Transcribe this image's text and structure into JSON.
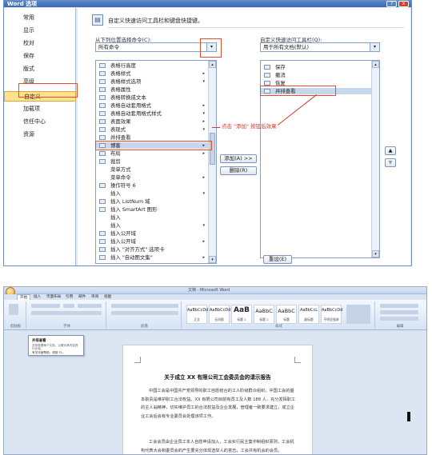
{
  "dialog": {
    "title": "Word 选项",
    "help_glyph": "?",
    "close_glyph": "x",
    "nav": {
      "items": [
        "常用",
        "显示",
        "校对",
        "保存",
        "版式",
        "高级",
        "自定义",
        "加载项",
        "信任中心",
        "资源"
      ],
      "selected_index": 6
    },
    "header_icon": "▤",
    "header_text": "自定义快速访问工具栏和键盘快捷键。",
    "left_label": "从下列位置选择命令(C):",
    "left_combo": "所有命令",
    "right_label": "自定义快速访问工具栏(Q):",
    "right_combo": "用于所有文档(默认)",
    "combo_arrow": "▾",
    "left_list": [
      {
        "text": "表格行高度",
        "chev": ""
      },
      {
        "text": "表格样式",
        "chev": "▸"
      },
      {
        "text": "表格样式选项",
        "chev": "▾"
      },
      {
        "text": "表格属性",
        "chev": ""
      },
      {
        "text": "表格转换成文本",
        "chev": ""
      },
      {
        "text": "表格自动套用格式",
        "chev": "▸"
      },
      {
        "text": "表格自动套用格式样式",
        "chev": "▾"
      },
      {
        "text": "表面效果",
        "chev": "▸"
      },
      {
        "text": "表现式",
        "chev": "▾"
      },
      {
        "text": "并排查看",
        "chev": ""
      },
      {
        "text": "博客",
        "chev": "▸"
      },
      {
        "text": "布局",
        "chev": "▸"
      },
      {
        "text": "裁剪",
        "chev": ""
      },
      {
        "text": "菜单方式",
        "chev": ""
      },
      {
        "text": "菜单命令",
        "chev": "▸"
      },
      {
        "text": "操作符号 6",
        "chev": ""
      },
      {
        "text": "插入",
        "chev": "▾"
      },
      {
        "text": "插入 ListNum 域",
        "chev": ""
      },
      {
        "text": "插入 SmartArt 图形",
        "chev": ""
      },
      {
        "text": "插入",
        "chev": ""
      },
      {
        "text": "插入",
        "chev": "▾"
      },
      {
        "text": "插入公开域",
        "chev": ""
      },
      {
        "text": "插入公开域",
        "chev": "▸"
      },
      {
        "text": "插入 \"对齐方式\" 选项卡",
        "chev": ""
      },
      {
        "text": "插入 \"自动图文集\"",
        "chev": "▸"
      }
    ],
    "left_selected_index": 10,
    "right_list": [
      "保存",
      "撤消",
      "恢复",
      "并排查看"
    ],
    "right_selected_index": 3,
    "add_button": "添加(A) >>",
    "remove_button": "删除(R)",
    "reset_button": "重设(E)",
    "move_up": "▲",
    "move_down": "▼",
    "annotation": "点击 \"添加\" 按钮后效果",
    "scroll_up": "▴",
    "scroll_down": "▾"
  },
  "word": {
    "title": "文档 - Microsoft Word",
    "tabs": [
      "开始",
      "插入",
      "页面布局",
      "引用",
      "邮件",
      "审阅",
      "视图"
    ],
    "selected_tab": 0,
    "groups": [
      "剪贴板",
      "字体",
      "段落",
      "样式",
      "编辑"
    ],
    "styles": [
      {
        "sample": "AaBbCcDd",
        "name": "正文"
      },
      {
        "sample": "AaBbCcDd",
        "name": "无间隔"
      },
      {
        "sample": "AaB",
        "name": "标题 1"
      },
      {
        "sample": "AaBbC",
        "name": "标题 2"
      },
      {
        "sample": "AaBbC",
        "name": "标题"
      },
      {
        "sample": "AaBbCcL",
        "name": "副标题"
      },
      {
        "sample": "AaBbCcDd",
        "name": "不明显强调"
      }
    ],
    "popup": {
      "title": "并排查看",
      "description": "并排查看两个文档，以便对其内容进行比较。",
      "footer": "有关详细帮助，请按 F1。"
    },
    "doc_title": "关于成立 XX 有限公司工会委员会的请示报告",
    "doc_paragraphs": [
      "中国工会是中国共产党领导的职工自愿结合的工人阶级群众组织，中国工会的基本职责是维护职工合法权益。XX 有限公司目前有员工及人数 188 人，充分发挥职工的主人翁精神，切实维护员工的合法权益及企业发展，管理者一致要求建立，成立企业工会后会有专业委员会处理该项工作。",
      "工会会员由企业员工本人自愿申请加入，工会实行民主集中制组织原则，工会机构代表大会和委员会的产生要充分体现选举人的意志，工会共有机会的会员。"
    ]
  }
}
